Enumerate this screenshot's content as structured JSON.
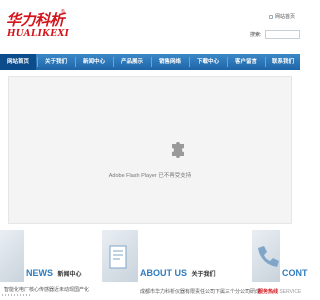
{
  "header": {
    "logo_cn": "华力科析",
    "logo_reg": "®",
    "logo_en": "HUALIKEXI",
    "top_link": "网站首页",
    "search_label": "搜索:",
    "search_value": ""
  },
  "nav": {
    "items": [
      {
        "label": "网站首页",
        "active": true
      },
      {
        "label": "关于我们",
        "active": false
      },
      {
        "label": "新闻中心",
        "active": false
      },
      {
        "label": "产品展示",
        "active": false
      },
      {
        "label": "销售网络",
        "active": false
      },
      {
        "label": "下载中心",
        "active": false
      },
      {
        "label": "客户留言",
        "active": false
      },
      {
        "label": "联系我们",
        "active": false
      }
    ]
  },
  "banner": {
    "plugin_message": "Adobe Flash Player 已不再受支持"
  },
  "sections": {
    "news": {
      "title_en": "NEWS",
      "title_cn": "新闻中心",
      "line": "智能化电厂核心传感器近未动现国产化"
    },
    "about": {
      "title_en": "ABOUT US",
      "title_cn": "关于我们",
      "line": "成都市华力科析仪器有限责任公司下属三个分公司研成"
    },
    "contact": {
      "title_en": "CONT",
      "line_cn": "服务热线",
      "line_en": "SERVICE"
    }
  },
  "colors": {
    "brand_red": "#d4141b",
    "nav_blue": "#2a77bb",
    "accent_blue": "#2f7cc1"
  }
}
